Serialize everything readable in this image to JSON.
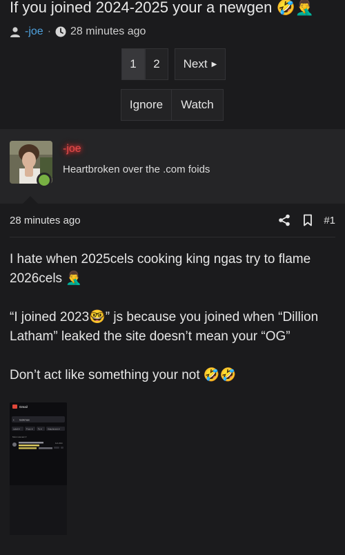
{
  "thread": {
    "title": "If you joined 2024-2025 your a newgen 🤣🤦‍♂️",
    "author": "-joe",
    "separator": "·",
    "time": "28 minutes ago"
  },
  "pagination": {
    "pages": [
      "1",
      "2"
    ],
    "current": "1",
    "next_label": "Next"
  },
  "thread_actions": {
    "ignore_label": "Ignore",
    "watch_label": "Watch"
  },
  "post": {
    "username": "-joe",
    "user_title": "Heartbroken over the .com foids",
    "time": "28 minutes ago",
    "number": "#1",
    "paragraphs": [
      "I hate when 2025cels cooking king ngas try to flame 2026cels 🤦‍♂️",
      "“I joined 2023🤓” js because you joined when “Dillion Latham” leaked the site doesn’t mean your “OG”",
      "Don’t act like something your not 🤣🤣"
    ],
    "attachment": {
      "app_name": "Gmail",
      "search_text": "lookmax",
      "chips": [
        "Label ▾",
        "From ▾",
        "To ▾",
        "Attachment ▾"
      ],
      "section_label": "Most relevant ▾",
      "result_date": "Feb 2024"
    }
  },
  "colors": {
    "background": "#1b1b1d",
    "user_block": "#252527",
    "link": "#4fa3e0",
    "username_glow": "#e74c4c",
    "online": "#78b043"
  },
  "icons": {
    "user": "user-icon",
    "clock": "clock-icon",
    "share": "share-icon",
    "bookmark": "bookmark-icon",
    "next_arrow": "caret-right-icon"
  }
}
